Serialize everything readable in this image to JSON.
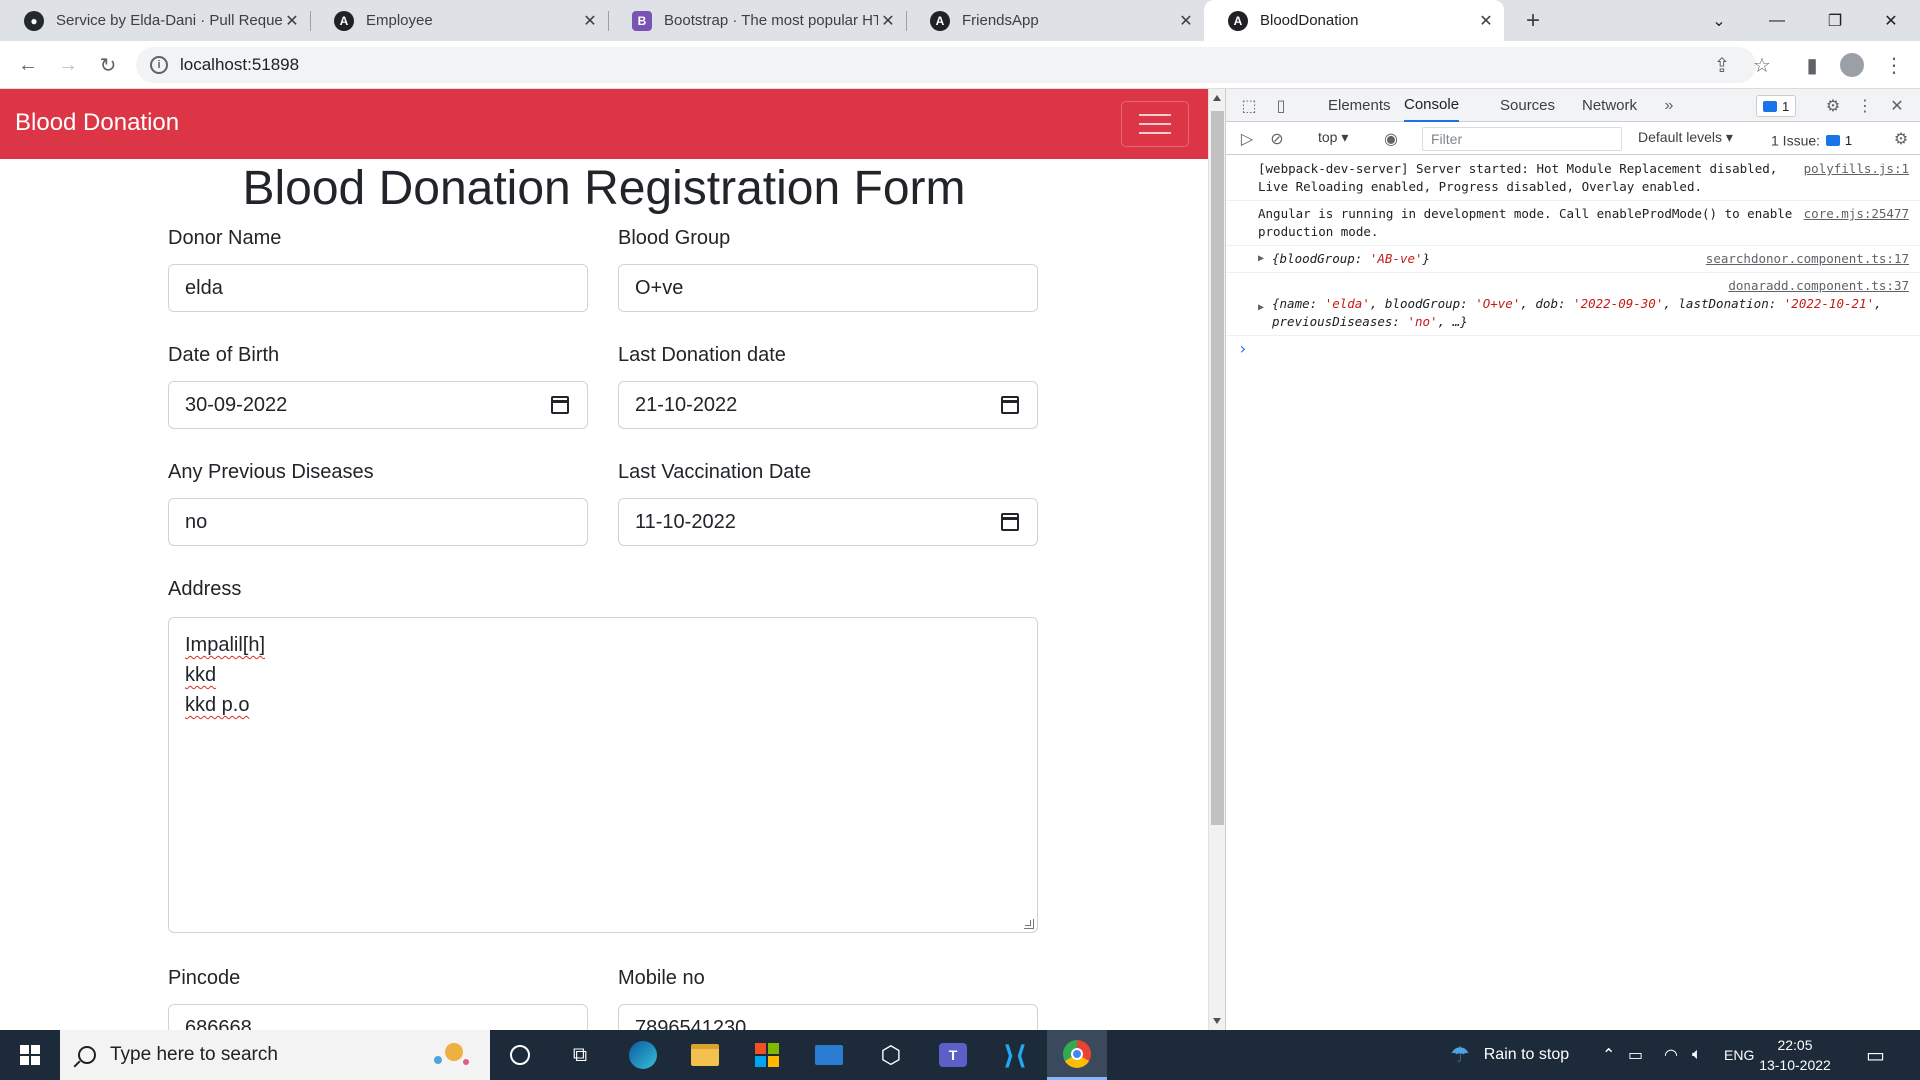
{
  "browser": {
    "tabs": [
      {
        "title": "Service by Elda-Dani · Pull Reque",
        "icon": "github-icon",
        "active": false
      },
      {
        "title": "Employee",
        "icon": "angular-icon",
        "active": false
      },
      {
        "title": "Bootstrap · The most popular HTI",
        "icon": "bootstrap-icon",
        "active": false
      },
      {
        "title": "FriendsApp",
        "icon": "angular-icon",
        "active": false
      },
      {
        "title": "BloodDonation",
        "icon": "angular-icon",
        "active": true
      }
    ],
    "url": "localhost:51898"
  },
  "page": {
    "brand": "Blood Donation",
    "form_title": "Blood Donation Registration Form",
    "fields": {
      "donor_name": {
        "label": "Donor Name",
        "value": "elda"
      },
      "blood_group": {
        "label": "Blood Group",
        "value": "O+ve"
      },
      "dob": {
        "label": "Date of Birth",
        "value": "30-09-2022"
      },
      "last_donation": {
        "label": "Last Donation date",
        "value": "21-10-2022"
      },
      "previous_diseases": {
        "label": "Any Previous Diseases",
        "value": "no"
      },
      "last_vaccination": {
        "label": "Last Vaccination Date",
        "value": "11-10-2022"
      },
      "address": {
        "label": "Address",
        "lines": [
          "Impalil[h]",
          "kkd",
          "kkd p.o"
        ]
      },
      "pincode": {
        "label": "Pincode",
        "value": "686668"
      },
      "mobile": {
        "label": "Mobile no",
        "value": "7896541230"
      }
    },
    "navbar_color": "#dc3545"
  },
  "devtools": {
    "tabs": [
      "Elements",
      "Console",
      "Sources",
      "Network"
    ],
    "active_tab": "Console",
    "messages_badge": "1",
    "context": "top",
    "filter_placeholder": "Filter",
    "levels": "Default levels",
    "issues": "1 Issue:",
    "issues_count": "1",
    "console": [
      {
        "text": "[webpack-dev-server] Server started: Hot Module Replacement disabled, Live Reloading enabled, Progress disabled, Overlay enabled.",
        "source": "polyfills.js:1"
      },
      {
        "text": "Angular is running in development mode. Call enableProdMode() to enable production mode.",
        "source": "core.mjs:25477"
      },
      {
        "source": "searchdonor.component.ts:17",
        "obj_prefix": "{bloodGroup: ",
        "obj_val": "'AB-ve'",
        "obj_suffix": "}"
      },
      {
        "source": "donaradd.component.ts:37",
        "p1": "{name: ",
        "v1": "'elda'",
        "p2": ", bloodGroup: ",
        "v2": "'O+ve'",
        "p3": ", dob: ",
        "v3": "'2022-09-30'",
        "p4": ", lastDonation: ",
        "v4": "'2022-10-21'",
        "p5": ", previousDiseases: ",
        "v5": "'no'",
        "p6": ", …}"
      }
    ]
  },
  "taskbar": {
    "search_placeholder": "Type here to search",
    "weather": "Rain to stop",
    "language": "ENG",
    "time": "22:05",
    "date": "13-10-2022"
  }
}
